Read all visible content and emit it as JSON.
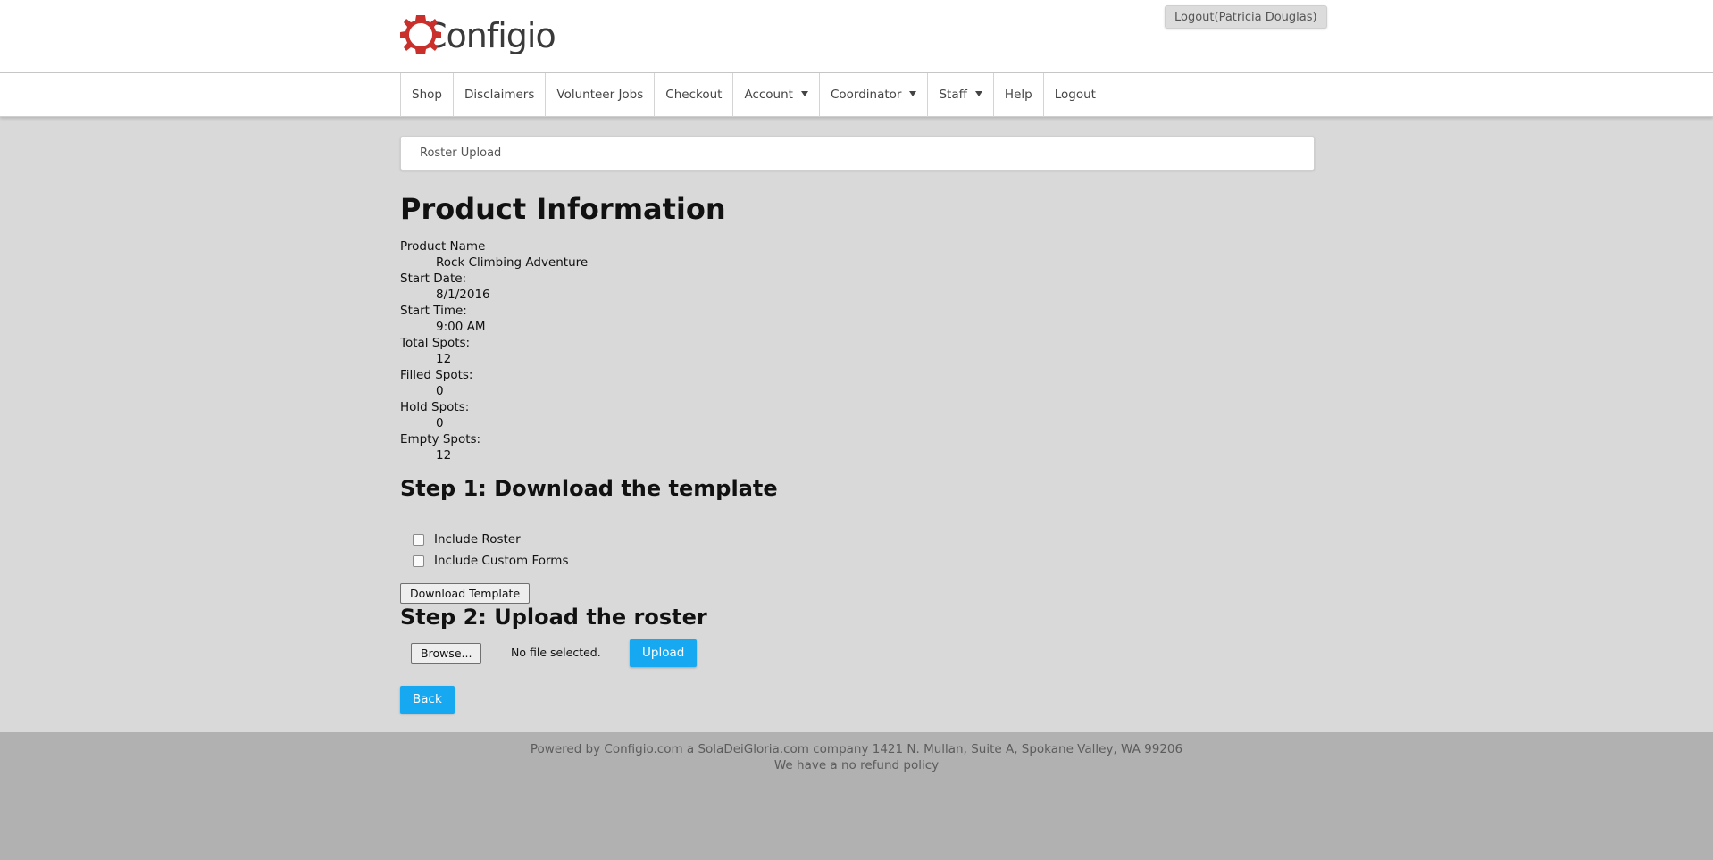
{
  "header": {
    "logo_text": "Configio",
    "logout_label": "Logout(Patricia Douglas)"
  },
  "nav": {
    "items": [
      {
        "label": "Shop",
        "dropdown": false
      },
      {
        "label": "Disclaimers",
        "dropdown": false
      },
      {
        "label": "Volunteer Jobs",
        "dropdown": false
      },
      {
        "label": "Checkout",
        "dropdown": false
      },
      {
        "label": "Account",
        "dropdown": true
      },
      {
        "label": "Coordinator",
        "dropdown": true
      },
      {
        "label": "Staff",
        "dropdown": true
      },
      {
        "label": "Help",
        "dropdown": false
      },
      {
        "label": "Logout",
        "dropdown": false
      }
    ]
  },
  "breadcrumb": "Roster Upload",
  "page": {
    "title": "Product Information",
    "fields": [
      {
        "label": "Product Name",
        "value": "Rock Climbing Adventure"
      },
      {
        "label": "Start Date:",
        "value": "8/1/2016"
      },
      {
        "label": "Start Time:",
        "value": "9:00 AM"
      },
      {
        "label": "Total Spots:",
        "value": "12"
      },
      {
        "label": "Filled Spots:",
        "value": "0"
      },
      {
        "label": "Hold Spots:",
        "value": "0"
      },
      {
        "label": "Empty Spots:",
        "value": "12"
      }
    ]
  },
  "step1": {
    "heading": "Step 1: Download the template",
    "include_roster_label": "Include Roster",
    "include_custom_forms_label": "Include Custom Forms",
    "download_button": "Download Template"
  },
  "step2": {
    "heading": "Step 2: Upload the roster",
    "browse_button": "Browse...",
    "file_status": "No file selected.",
    "upload_button": "Upload"
  },
  "back_button": "Back",
  "footer": {
    "line1": "Powered by Configio.com a SolaDeiGloria.com company 1421 N. Mullan, Suite A, Spokane Valley, WA 99206",
    "line2": "We have a no refund policy"
  },
  "colors": {
    "brand_red": "#c9302c",
    "accent_blue": "#16a9f2",
    "page_bg": "#d9d9d9",
    "footer_bg": "#b1b1b1"
  }
}
